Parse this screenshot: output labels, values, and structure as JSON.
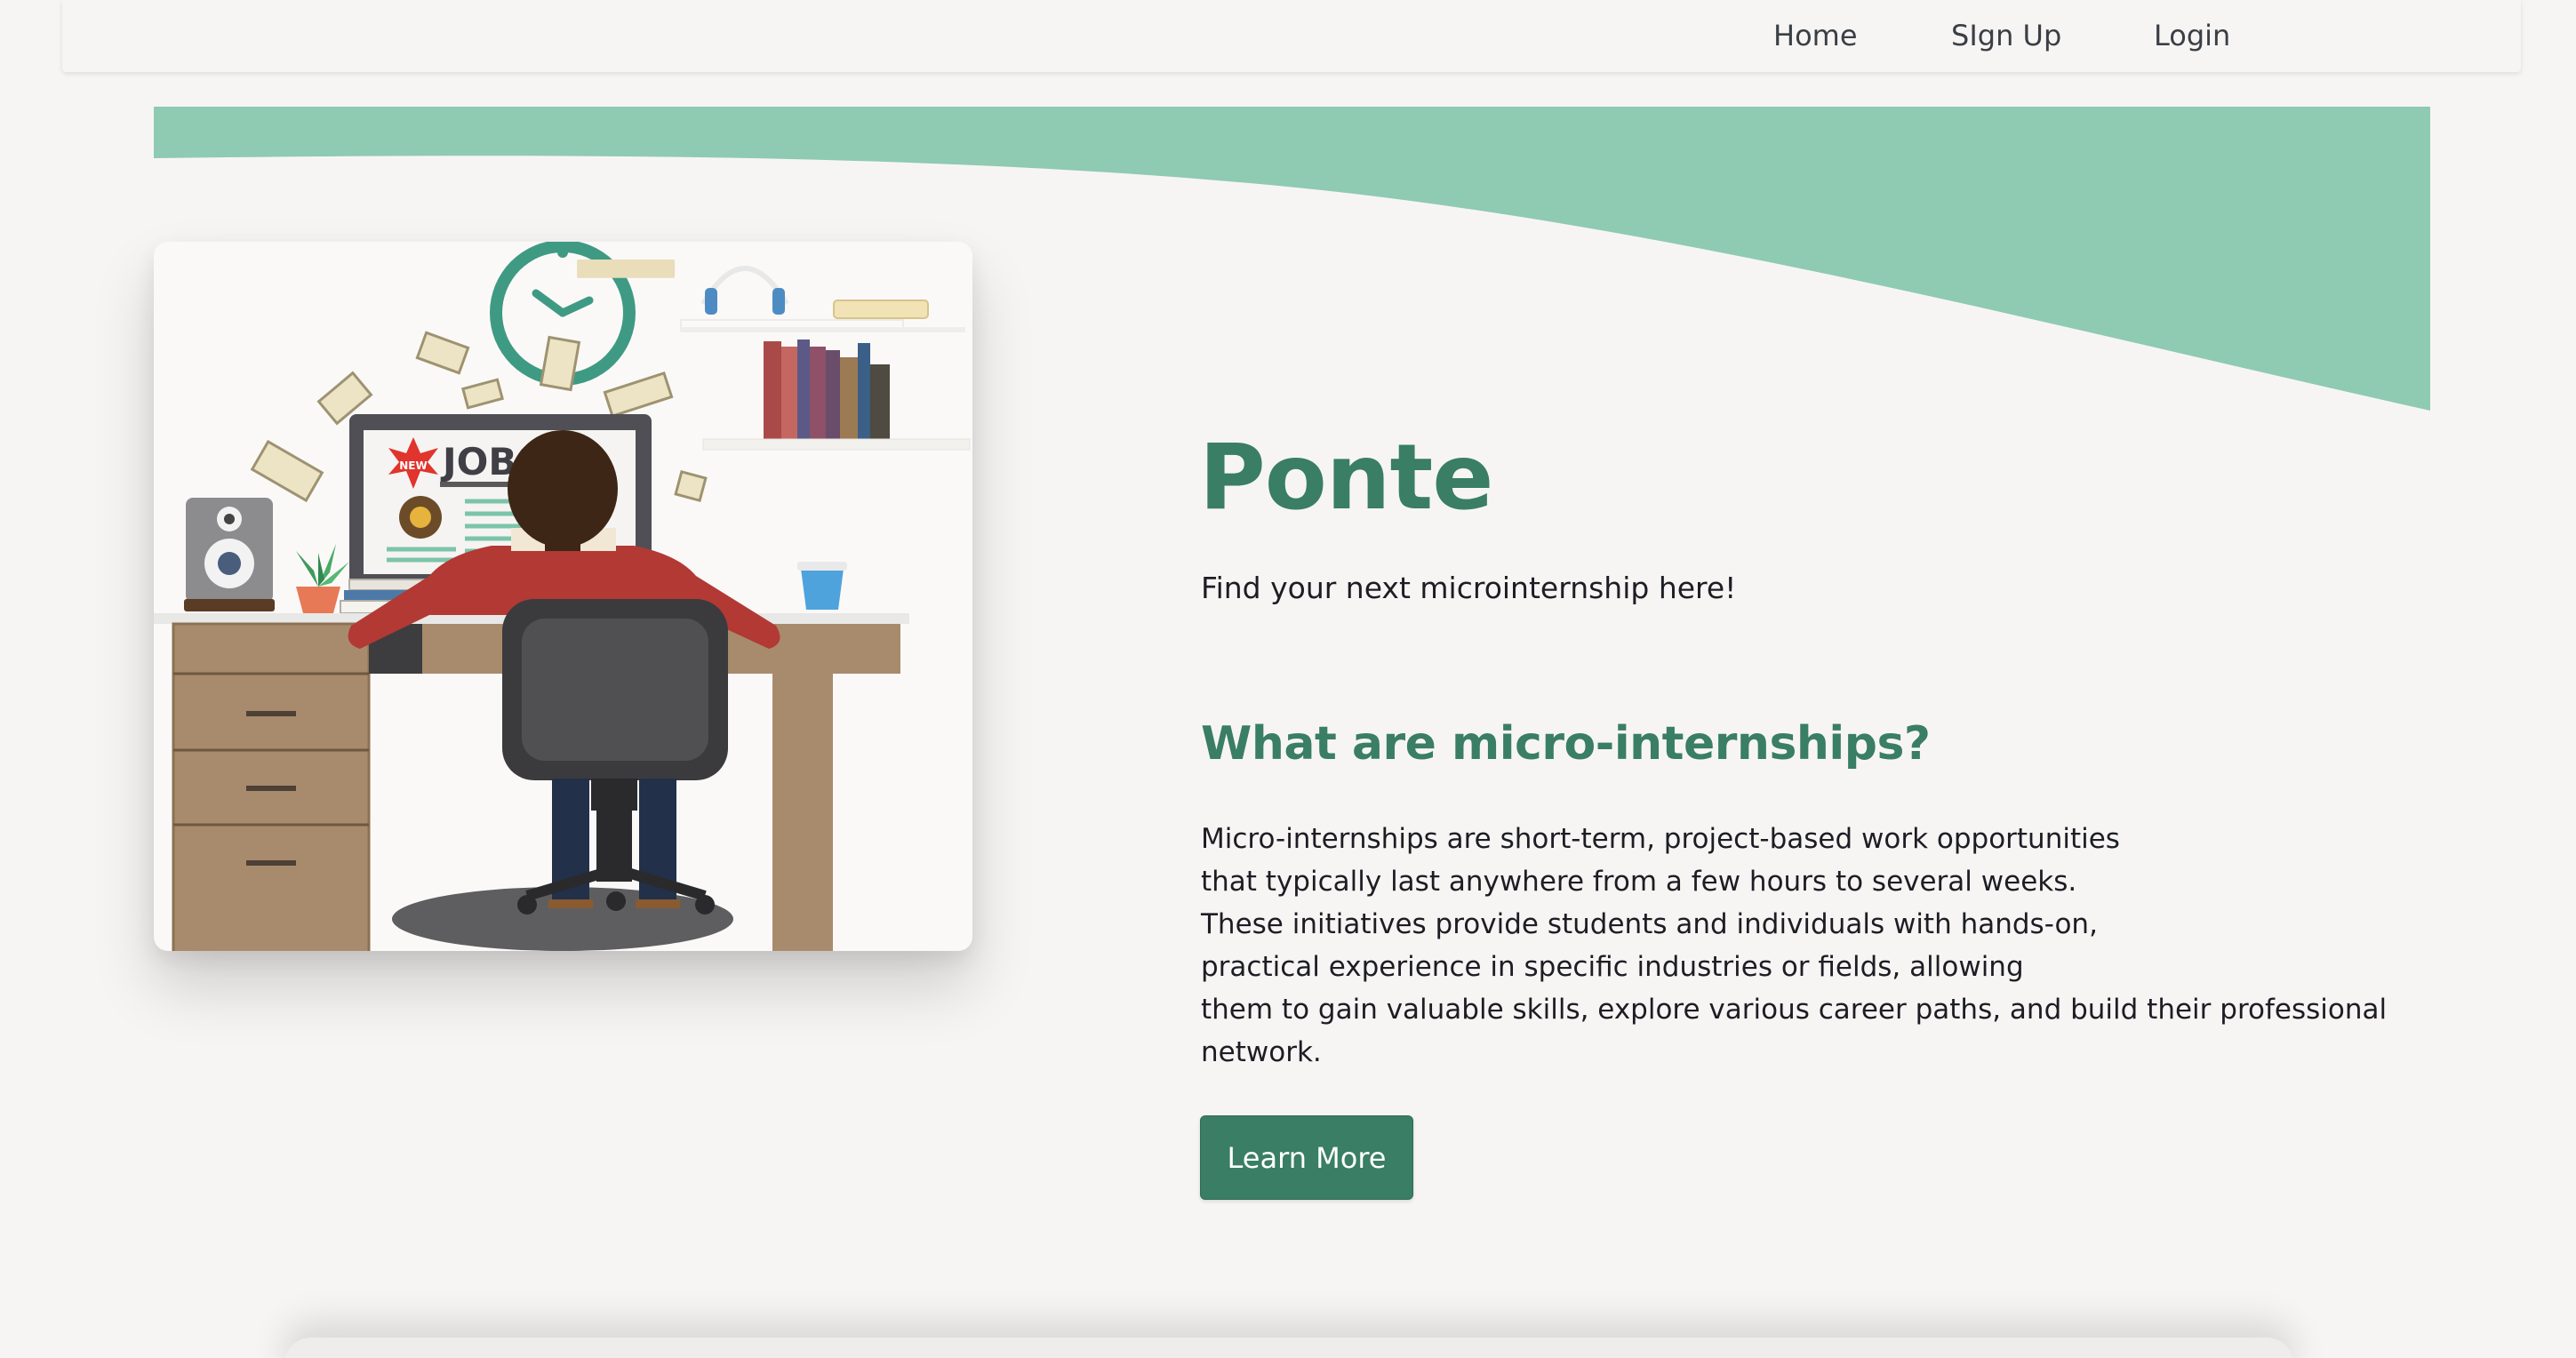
{
  "nav": {
    "items": [
      {
        "label": "Home"
      },
      {
        "label": "SIgn Up"
      },
      {
        "label": "Login"
      }
    ]
  },
  "hero": {
    "title": "Ponte",
    "tagline": "Find your next microinternship here!",
    "image": {
      "monitor_text": "JOBS",
      "badge_text": "NEW"
    }
  },
  "about": {
    "heading": "What are micro-internships?",
    "lines": [
      "Micro-internships are short-term, project-based work opportunities",
      "that typically last anywhere from a few hours to several weeks.",
      "These initiatives provide students and individuals with hands-on,",
      "practical experience in specific industries or fields, allowing",
      "them to gain valuable skills, explore various career paths, and build their professional",
      "network."
    ],
    "button_label": "Learn More"
  },
  "colors": {
    "accent": "#397e65",
    "wave": "#8fcab3",
    "background": "#f7f5f4"
  }
}
